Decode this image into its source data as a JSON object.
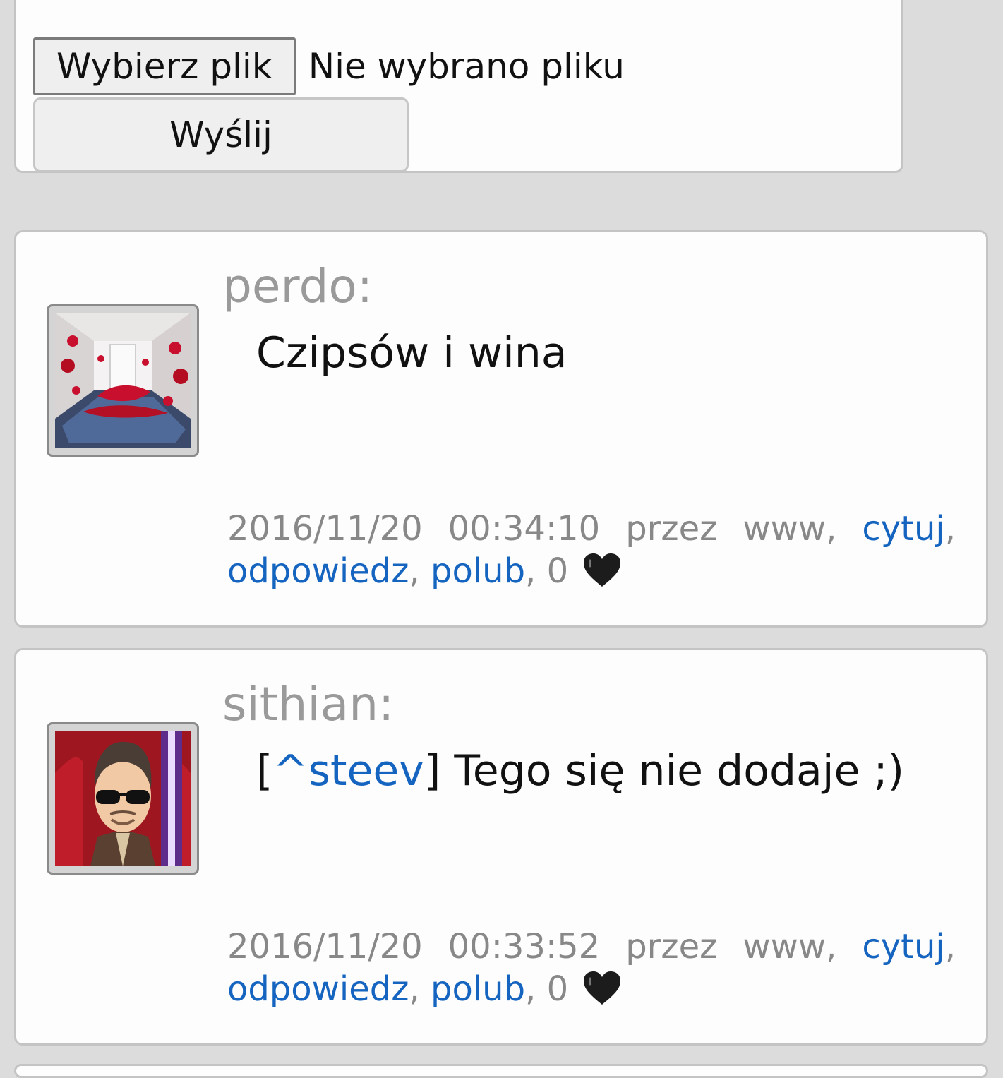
{
  "form": {
    "file_button_label": "Wybierz plik",
    "file_status": "Nie wybrano pliku",
    "submit_label": "Wyślij"
  },
  "posts": [
    {
      "author": "perdo:",
      "message": "Czipsów i wina",
      "date": "2016/11/20",
      "time": "00:34:10",
      "via_label": "przez",
      "via": "www,",
      "quote_link": "cytuj",
      "reply_link": "odpowiedz",
      "like_link": "polub",
      "likes": "0",
      "avatar_icon": "blood-hallway-photo"
    },
    {
      "author": "sithian:",
      "quote_prefix": "[",
      "quote_user": "^steev",
      "quote_suffix": "]",
      "message": "Tego się nie dodaje ;)",
      "date": "2016/11/20",
      "time": "00:33:52",
      "via_label": "przez",
      "via": "www,",
      "quote_link": "cytuj",
      "reply_link": "odpowiedz",
      "like_link": "polub",
      "likes": "0",
      "avatar_icon": "sunglasses-man-cartoon"
    }
  ],
  "colors": {
    "link": "#1565c0",
    "meta": "#888888",
    "author": "#9a9a9a",
    "background": "#dcdcdc"
  }
}
